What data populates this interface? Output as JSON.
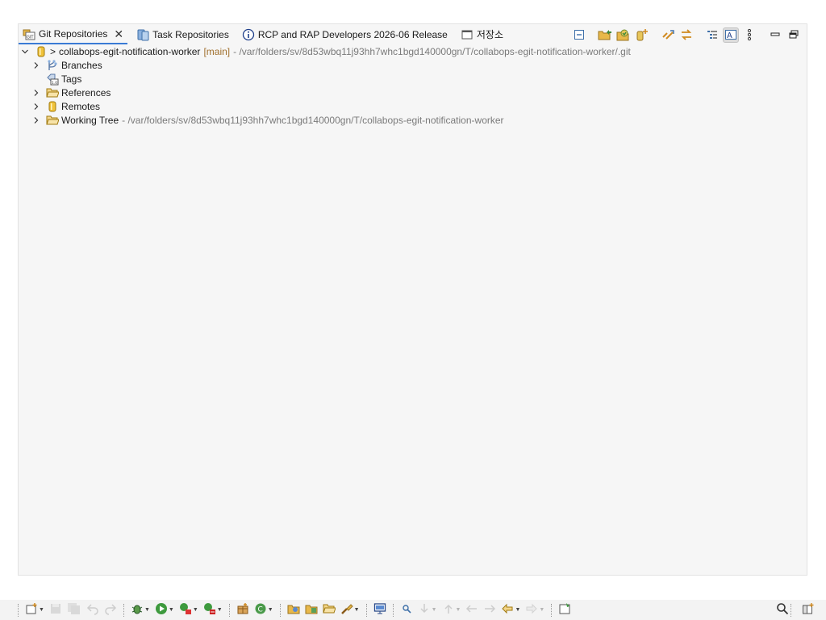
{
  "tabs": [
    {
      "label": "Git Repositories",
      "icon": "git-repositories-icon",
      "active": true,
      "closable": true
    },
    {
      "label": "Task Repositories",
      "icon": "task-repositories-icon"
    },
    {
      "label": "RCP and RAP Developers 2026-06 Release",
      "icon": "info-icon"
    },
    {
      "label": "저장소",
      "icon": "window-icon"
    }
  ],
  "tree": {
    "repo": {
      "prefix": ">",
      "name": "collabops-egit-notification-worker",
      "branch": "[main]",
      "path": "- /var/folders/sv/8d53wbq11j93hh7whc1bgd140000gn/T/collabops-egit-notification-worker/.git"
    },
    "nodes": [
      {
        "label": "Branches",
        "icon": "branches-icon",
        "expandable": true
      },
      {
        "label": "Tags",
        "icon": "tags-icon",
        "expandable": false
      },
      {
        "label": "References",
        "icon": "folder-icon",
        "expandable": true
      },
      {
        "label": "Remotes",
        "icon": "remotes-icon",
        "expandable": true
      },
      {
        "label": "Working Tree",
        "icon": "folder-icon",
        "expandable": true,
        "path": "- /var/folders/sv/8d53wbq11j93hh7whc1bgd140000gn/T/collabops-egit-notification-worker"
      }
    ]
  },
  "view_toolbar": [
    "collapse-all-icon",
    "add-existing-repository-icon",
    "clone-repository-icon",
    "create-repository-icon",
    "link-with-selection-icon",
    "link-with-editor-icon",
    "hierarchical-branch-icon",
    "show-details-icon",
    "view-menu-icon",
    "minimize-icon",
    "maximize-icon"
  ],
  "colors": {
    "accent": "#3a7bd5",
    "branch": "#a0702e",
    "dim": "#7a7a7a",
    "view_bg": "#f6f6f6"
  }
}
